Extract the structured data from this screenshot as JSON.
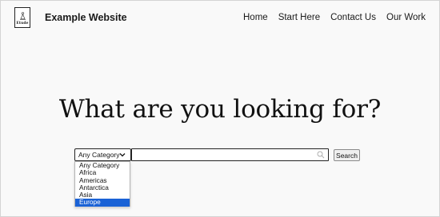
{
  "header": {
    "logo_text": "Etude",
    "site_title": "Example Website",
    "nav": [
      {
        "label": "Home"
      },
      {
        "label": "Start Here"
      },
      {
        "label": "Contact Us"
      },
      {
        "label": "Our Work"
      }
    ]
  },
  "hero": {
    "title": "What are you looking for?"
  },
  "search": {
    "category_selected": "Any Category",
    "query_value": "",
    "button_label": "Search",
    "category_options": [
      {
        "label": "Any Category",
        "selected": false
      },
      {
        "label": "Africa",
        "selected": false
      },
      {
        "label": "Americas",
        "selected": false
      },
      {
        "label": "Antarctica",
        "selected": false
      },
      {
        "label": "Asia",
        "selected": false
      },
      {
        "label": "Europe",
        "selected": true
      }
    ],
    "highlight_color": "#1a62d6"
  },
  "icons": {
    "logo": "figure-logo-icon",
    "select": "chevron-down-icon",
    "search_field": "search-icon"
  }
}
